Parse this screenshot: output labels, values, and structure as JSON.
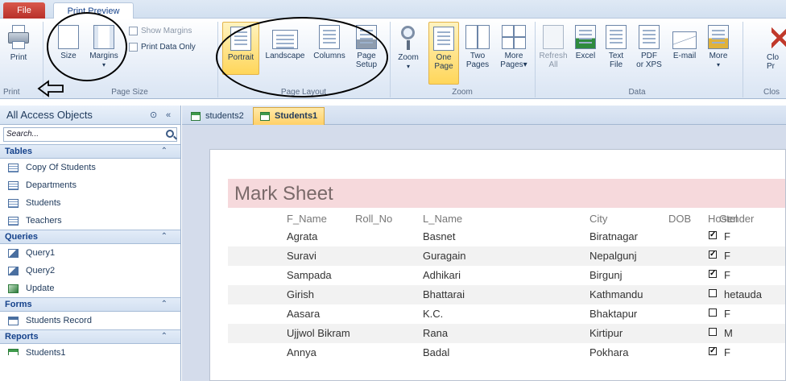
{
  "tabs": {
    "file": "File",
    "print_preview": "Print Preview"
  },
  "ribbon": {
    "print_group": {
      "print": "Print",
      "label": "Print"
    },
    "page_size": {
      "size": "Size",
      "margins": "Margins",
      "show_margins": "Show Margins",
      "print_data_only": "Print Data Only",
      "label": "Page Size"
    },
    "page_layout": {
      "portrait": "Portrait",
      "landscape": "Landscape",
      "columns": "Columns",
      "page_setup_1": "Page",
      "page_setup_2": "Setup",
      "label": "Page Layout"
    },
    "zoom_group": {
      "zoom": "Zoom",
      "one_page_1": "One",
      "one_page_2": "Page",
      "two_pages_1": "Two",
      "two_pages_2": "Pages",
      "more_pages_1": "More",
      "more_pages_2": "Pages",
      "label": "Zoom"
    },
    "data_group": {
      "refresh_1": "Refresh",
      "refresh_2": "All",
      "excel": "Excel",
      "text_file_1": "Text",
      "text_file_2": "File",
      "pdf_1": "PDF",
      "pdf_2": "or XPS",
      "email": "E-mail",
      "more": "More",
      "label": "Data"
    },
    "close_group": {
      "close_1": "Clo",
      "close_2": "Pr",
      "label": "Clos"
    }
  },
  "nav": {
    "title": "All Access Objects",
    "search_placeholder": "Search...",
    "sections": [
      {
        "label": "Tables",
        "items": [
          "Copy Of Students",
          "Departments",
          "Students",
          "Teachers"
        ]
      },
      {
        "label": "Queries",
        "items": [
          "Query1",
          "Query2",
          "Update"
        ]
      },
      {
        "label": "Forms",
        "items": [
          "Students Record"
        ]
      },
      {
        "label": "Reports",
        "items": [
          "Students1"
        ]
      }
    ]
  },
  "doc_tabs": [
    "students2",
    "Students1"
  ],
  "report": {
    "title": "Mark Sheet",
    "headers": {
      "f_name": "F_Name",
      "roll_no": "Roll_No",
      "l_name": "L_Name",
      "city": "City",
      "dob": "DOB",
      "hostel": "Hostel",
      "gender": "Gender"
    },
    "rows": [
      {
        "f_name": "Agrata",
        "l_name": "Basnet",
        "city": "Biratnagar",
        "hostel": true,
        "gender": "F"
      },
      {
        "f_name": "Suravi",
        "l_name": "Guragain",
        "city": "Nepalgunj",
        "hostel": true,
        "gender": "F"
      },
      {
        "f_name": "Sampada",
        "l_name": "Adhikari",
        "city": "Birgunj",
        "hostel": true,
        "gender": "F"
      },
      {
        "f_name": "Girish",
        "l_name": "Bhattarai",
        "city": "Kathmandu",
        "hostel": false,
        "gender": "hetauda"
      },
      {
        "f_name": "Aasara",
        "l_name": "K.C.",
        "city": "Bhaktapur",
        "hostel": false,
        "gender": "F"
      },
      {
        "f_name": "Ujjwol Bikram",
        "l_name": "Rana",
        "city": "Kirtipur",
        "hostel": false,
        "gender": "M"
      },
      {
        "f_name": "Annya",
        "l_name": "Badal",
        "city": "Pokhara",
        "hostel": true,
        "gender": "F"
      }
    ]
  },
  "colors": {
    "accent": "#ffd067",
    "title_band": "#f6d9dc",
    "file_tab": "#b8302a"
  }
}
